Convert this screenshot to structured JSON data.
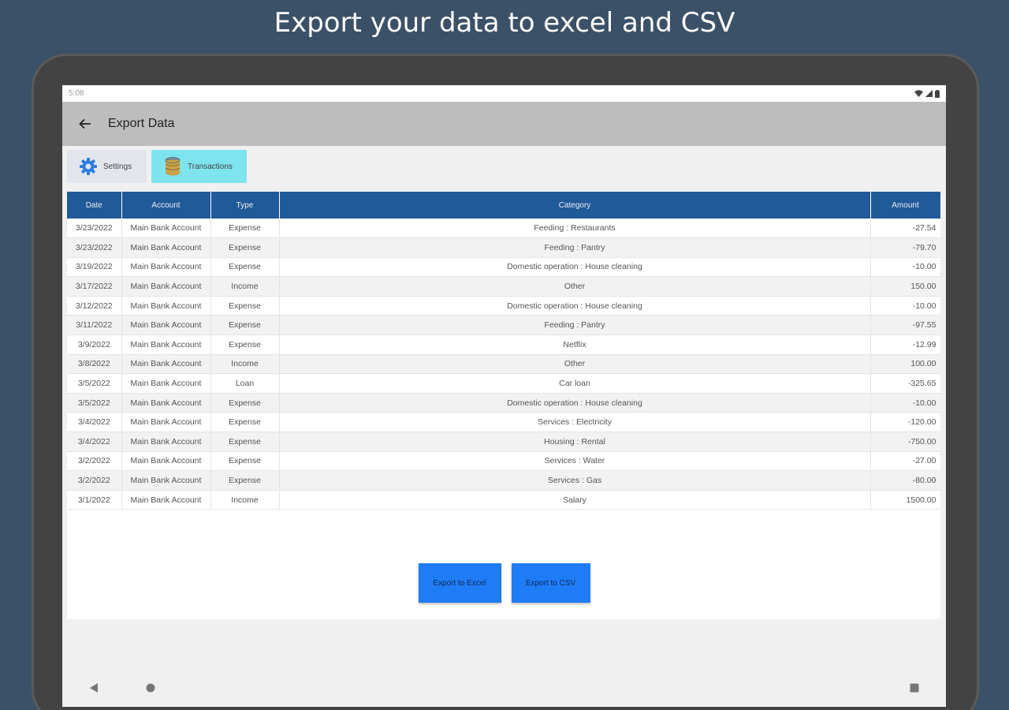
{
  "headline": "Export your data to excel and CSV",
  "status_bar": {
    "time": "5:08",
    "icons": [
      "wifi-icon",
      "signal-icon",
      "battery-icon"
    ]
  },
  "app_bar": {
    "title": "Export Data",
    "back_icon": "arrow-left-icon"
  },
  "tabs": [
    {
      "label": "Settings",
      "icon": "gear-icon",
      "selected": false
    },
    {
      "label": "Transactions",
      "icon": "database-icon",
      "selected": true
    }
  ],
  "table": {
    "headers": [
      "Date",
      "Account",
      "Type",
      "Category",
      "Amount"
    ],
    "rows": [
      [
        "3/23/2022",
        "Main Bank Account",
        "Expense",
        "Feeding : Restaurants",
        "-27.54"
      ],
      [
        "3/23/2022",
        "Main Bank Account",
        "Expense",
        "Feeding : Pantry",
        "-79.70"
      ],
      [
        "3/19/2022",
        "Main Bank Account",
        "Expense",
        "Domestic operation : House cleaning",
        "-10.00"
      ],
      [
        "3/17/2022",
        "Main Bank Account",
        "Income",
        "Other",
        "150.00"
      ],
      [
        "3/12/2022",
        "Main Bank Account",
        "Expense",
        "Domestic operation : House cleaning",
        "-10.00"
      ],
      [
        "3/11/2022",
        "Main Bank Account",
        "Expense",
        "Feeding : Pantry",
        "-97.55"
      ],
      [
        "3/9/2022",
        "Main Bank Account",
        "Expense",
        "Netflix",
        "-12.99"
      ],
      [
        "3/8/2022",
        "Main Bank Account",
        "Income",
        "Other",
        "100.00"
      ],
      [
        "3/5/2022",
        "Main Bank Account",
        "Loan",
        "Car loan",
        "-325.65"
      ],
      [
        "3/5/2022",
        "Main Bank Account",
        "Expense",
        "Domestic operation : House cleaning",
        "-10.00"
      ],
      [
        "3/4/2022",
        "Main Bank Account",
        "Expense",
        "Services : Electricity",
        "-120.00"
      ],
      [
        "3/4/2022",
        "Main Bank Account",
        "Expense",
        "Housing : Rental",
        "-750.00"
      ],
      [
        "3/2/2022",
        "Main Bank Account",
        "Expense",
        "Services : Water",
        "-27.00"
      ],
      [
        "3/2/2022",
        "Main Bank Account",
        "Expense",
        "Services : Gas",
        "-80.00"
      ],
      [
        "3/1/2022",
        "Main Bank Account",
        "Income",
        "Salary",
        "1500.00"
      ]
    ]
  },
  "buttons": {
    "export_excel": "Export to Excel",
    "export_csv": "Export to CSV"
  },
  "nav_bar": {
    "icons": [
      "back-triangle-icon",
      "home-circle-icon",
      "recents-square-icon"
    ]
  },
  "colors": {
    "background": "#3b5168",
    "table_header": "#215a98",
    "tab_selected": "#7ee4ee",
    "button": "#1e7cf7",
    "app_bar": "#bdbdbd"
  }
}
